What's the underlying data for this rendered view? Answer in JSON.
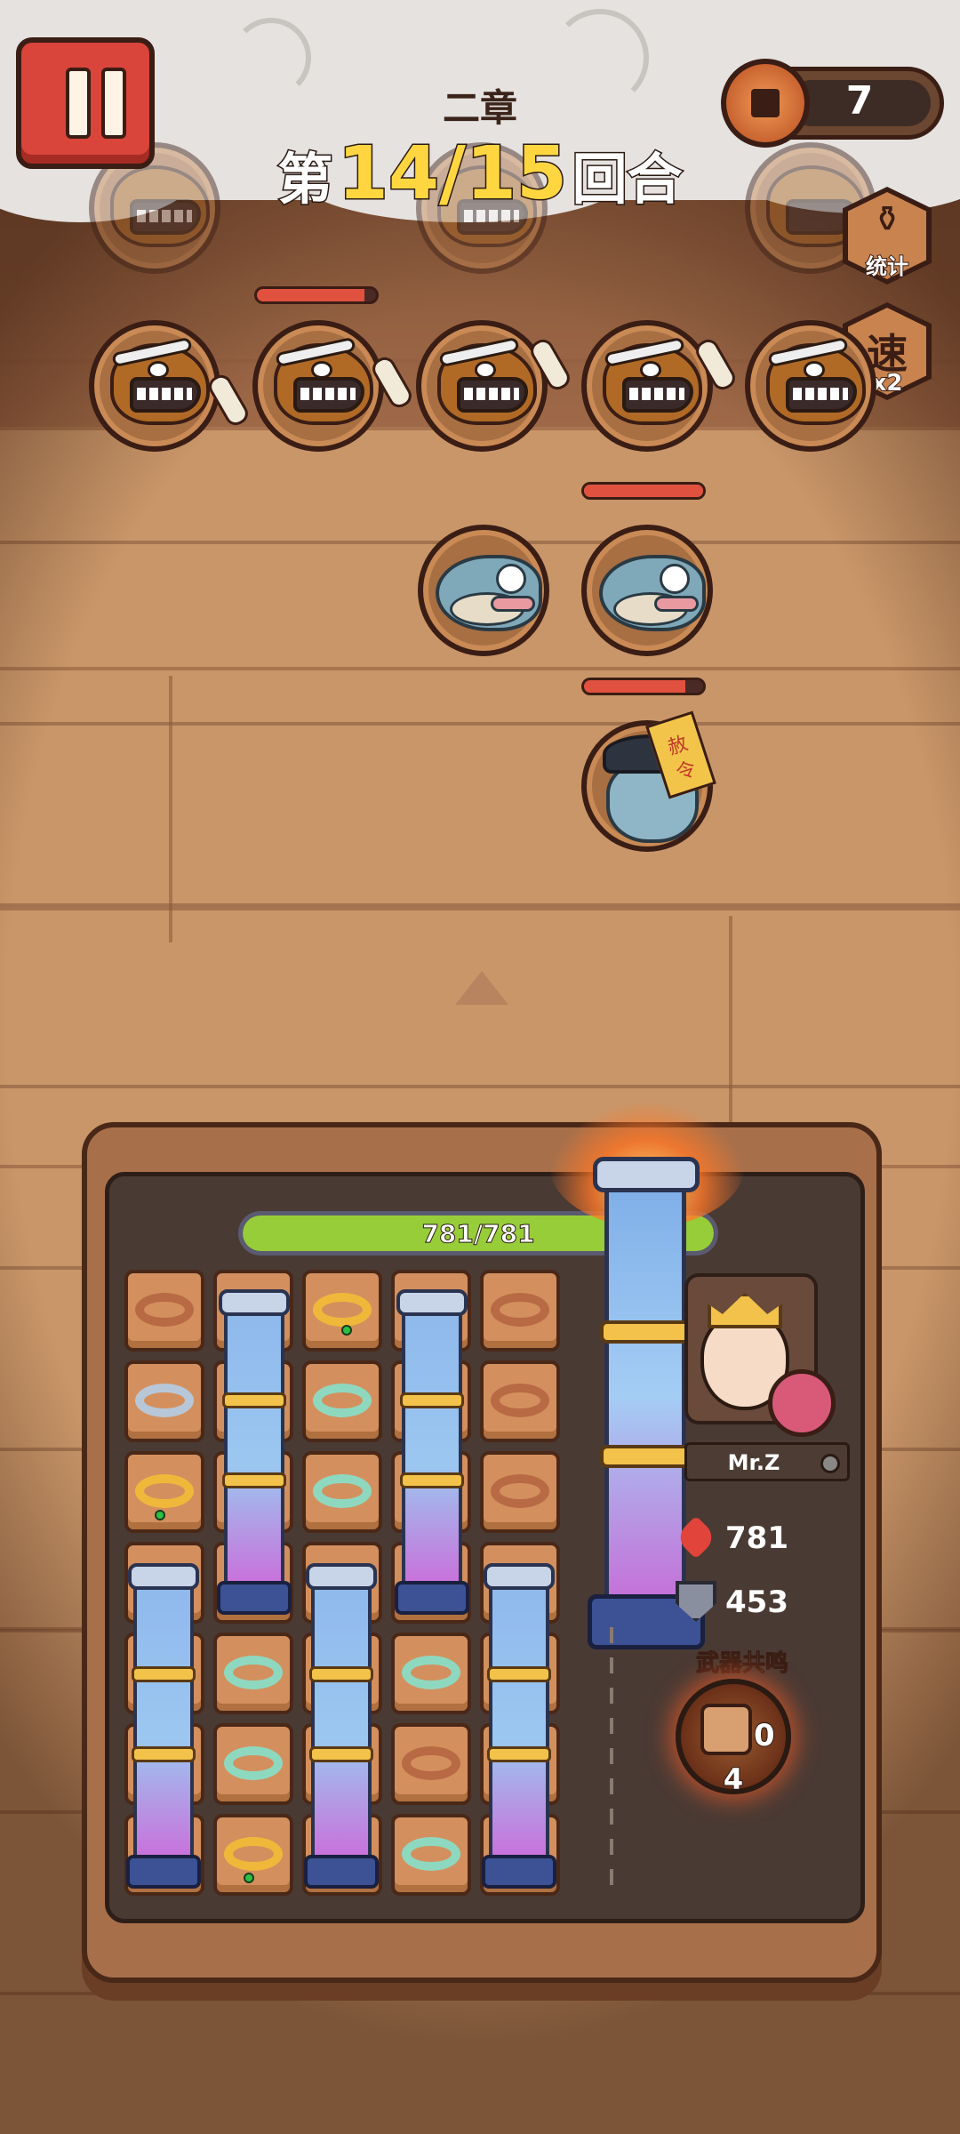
{
  "header": {
    "chapter": "二章",
    "round_prefix": "第",
    "round_current": "14",
    "round_total": "15",
    "round_suffix": "回合",
    "coins": "7"
  },
  "side_buttons": {
    "stats_label": "统计",
    "speed_glyph": "速",
    "speed_multiplier": "x2"
  },
  "player": {
    "name": "Mr.Z",
    "hp_current": 781,
    "hp_max": 781,
    "hp_text": "781/781",
    "hp_stat": "781",
    "defense_stat": "453"
  },
  "resonance": {
    "title": "武器共鸣",
    "count": "0",
    "level": "4"
  },
  "enemies": {
    "hyena_hp_fraction": 0.9,
    "fish_hp_fraction": 1.0,
    "zombie_hp_fraction": 0.85,
    "zombie_talisman": "赦令"
  },
  "colors": {
    "hp_fill": "#98cd3a",
    "round_highlight": "#ffd640",
    "pause_button": "#d9453a"
  },
  "icons": [
    "pause-icon",
    "coin-icon",
    "stats-icon",
    "speed-icon",
    "heart-icon",
    "shield-icon",
    "pipa-weapon-icon"
  ]
}
